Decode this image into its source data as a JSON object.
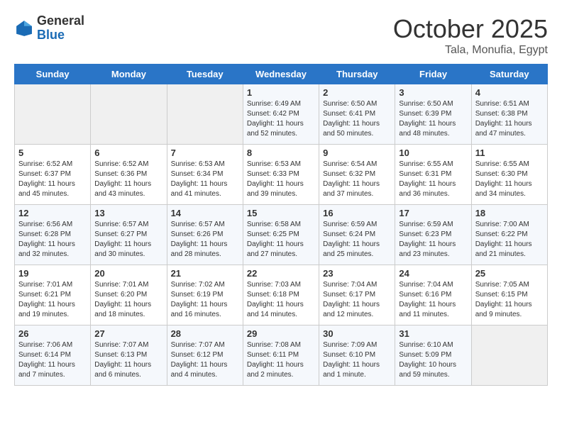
{
  "header": {
    "logo_general": "General",
    "logo_blue": "Blue",
    "month": "October 2025",
    "location": "Tala, Monufia, Egypt"
  },
  "days_of_week": [
    "Sunday",
    "Monday",
    "Tuesday",
    "Wednesday",
    "Thursday",
    "Friday",
    "Saturday"
  ],
  "weeks": [
    [
      {
        "day": "",
        "info": ""
      },
      {
        "day": "",
        "info": ""
      },
      {
        "day": "",
        "info": ""
      },
      {
        "day": "1",
        "info": "Sunrise: 6:49 AM\nSunset: 6:42 PM\nDaylight: 11 hours\nand 52 minutes."
      },
      {
        "day": "2",
        "info": "Sunrise: 6:50 AM\nSunset: 6:41 PM\nDaylight: 11 hours\nand 50 minutes."
      },
      {
        "day": "3",
        "info": "Sunrise: 6:50 AM\nSunset: 6:39 PM\nDaylight: 11 hours\nand 48 minutes."
      },
      {
        "day": "4",
        "info": "Sunrise: 6:51 AM\nSunset: 6:38 PM\nDaylight: 11 hours\nand 47 minutes."
      }
    ],
    [
      {
        "day": "5",
        "info": "Sunrise: 6:52 AM\nSunset: 6:37 PM\nDaylight: 11 hours\nand 45 minutes."
      },
      {
        "day": "6",
        "info": "Sunrise: 6:52 AM\nSunset: 6:36 PM\nDaylight: 11 hours\nand 43 minutes."
      },
      {
        "day": "7",
        "info": "Sunrise: 6:53 AM\nSunset: 6:34 PM\nDaylight: 11 hours\nand 41 minutes."
      },
      {
        "day": "8",
        "info": "Sunrise: 6:53 AM\nSunset: 6:33 PM\nDaylight: 11 hours\nand 39 minutes."
      },
      {
        "day": "9",
        "info": "Sunrise: 6:54 AM\nSunset: 6:32 PM\nDaylight: 11 hours\nand 37 minutes."
      },
      {
        "day": "10",
        "info": "Sunrise: 6:55 AM\nSunset: 6:31 PM\nDaylight: 11 hours\nand 36 minutes."
      },
      {
        "day": "11",
        "info": "Sunrise: 6:55 AM\nSunset: 6:30 PM\nDaylight: 11 hours\nand 34 minutes."
      }
    ],
    [
      {
        "day": "12",
        "info": "Sunrise: 6:56 AM\nSunset: 6:28 PM\nDaylight: 11 hours\nand 32 minutes."
      },
      {
        "day": "13",
        "info": "Sunrise: 6:57 AM\nSunset: 6:27 PM\nDaylight: 11 hours\nand 30 minutes."
      },
      {
        "day": "14",
        "info": "Sunrise: 6:57 AM\nSunset: 6:26 PM\nDaylight: 11 hours\nand 28 minutes."
      },
      {
        "day": "15",
        "info": "Sunrise: 6:58 AM\nSunset: 6:25 PM\nDaylight: 11 hours\nand 27 minutes."
      },
      {
        "day": "16",
        "info": "Sunrise: 6:59 AM\nSunset: 6:24 PM\nDaylight: 11 hours\nand 25 minutes."
      },
      {
        "day": "17",
        "info": "Sunrise: 6:59 AM\nSunset: 6:23 PM\nDaylight: 11 hours\nand 23 minutes."
      },
      {
        "day": "18",
        "info": "Sunrise: 7:00 AM\nSunset: 6:22 PM\nDaylight: 11 hours\nand 21 minutes."
      }
    ],
    [
      {
        "day": "19",
        "info": "Sunrise: 7:01 AM\nSunset: 6:21 PM\nDaylight: 11 hours\nand 19 minutes."
      },
      {
        "day": "20",
        "info": "Sunrise: 7:01 AM\nSunset: 6:20 PM\nDaylight: 11 hours\nand 18 minutes."
      },
      {
        "day": "21",
        "info": "Sunrise: 7:02 AM\nSunset: 6:19 PM\nDaylight: 11 hours\nand 16 minutes."
      },
      {
        "day": "22",
        "info": "Sunrise: 7:03 AM\nSunset: 6:18 PM\nDaylight: 11 hours\nand 14 minutes."
      },
      {
        "day": "23",
        "info": "Sunrise: 7:04 AM\nSunset: 6:17 PM\nDaylight: 11 hours\nand 12 minutes."
      },
      {
        "day": "24",
        "info": "Sunrise: 7:04 AM\nSunset: 6:16 PM\nDaylight: 11 hours\nand 11 minutes."
      },
      {
        "day": "25",
        "info": "Sunrise: 7:05 AM\nSunset: 6:15 PM\nDaylight: 11 hours\nand 9 minutes."
      }
    ],
    [
      {
        "day": "26",
        "info": "Sunrise: 7:06 AM\nSunset: 6:14 PM\nDaylight: 11 hours\nand 7 minutes."
      },
      {
        "day": "27",
        "info": "Sunrise: 7:07 AM\nSunset: 6:13 PM\nDaylight: 11 hours\nand 6 minutes."
      },
      {
        "day": "28",
        "info": "Sunrise: 7:07 AM\nSunset: 6:12 PM\nDaylight: 11 hours\nand 4 minutes."
      },
      {
        "day": "29",
        "info": "Sunrise: 7:08 AM\nSunset: 6:11 PM\nDaylight: 11 hours\nand 2 minutes."
      },
      {
        "day": "30",
        "info": "Sunrise: 7:09 AM\nSunset: 6:10 PM\nDaylight: 11 hours\nand 1 minute."
      },
      {
        "day": "31",
        "info": "Sunrise: 6:10 AM\nSunset: 5:09 PM\nDaylight: 10 hours\nand 59 minutes."
      },
      {
        "day": "",
        "info": ""
      }
    ]
  ]
}
